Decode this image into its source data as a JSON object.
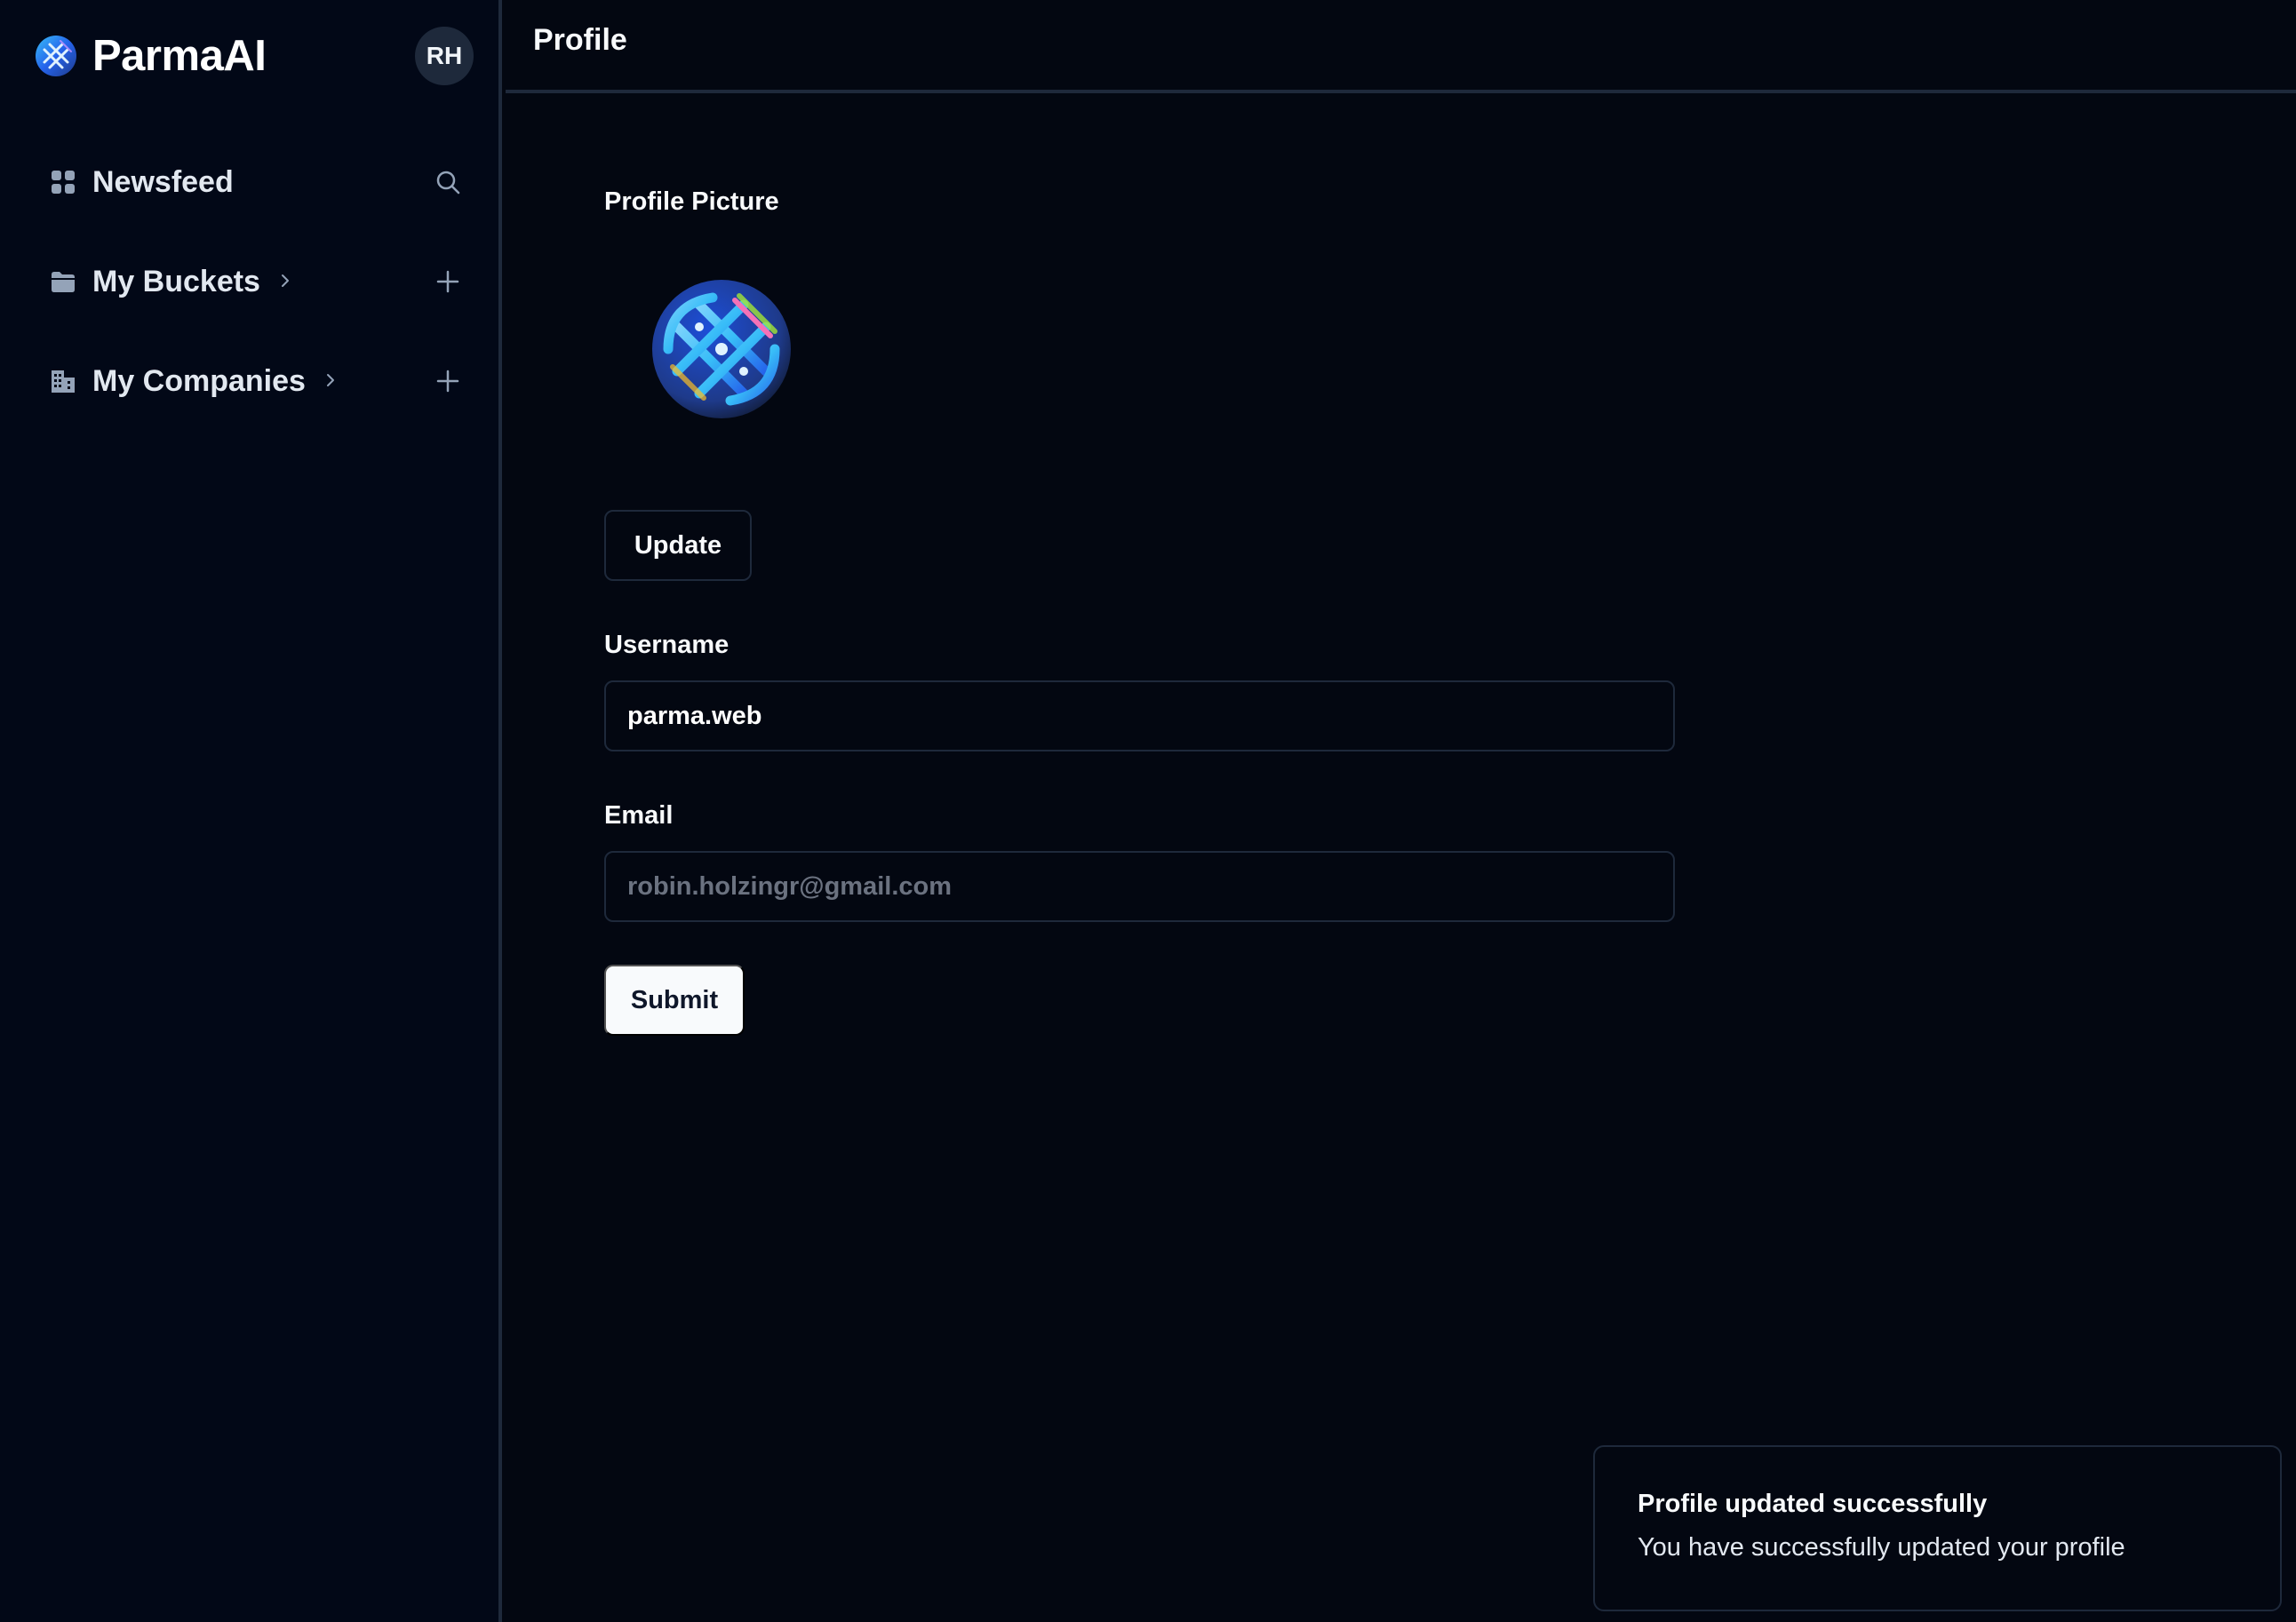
{
  "app": {
    "name": "ParmaAI",
    "user_initials": "RH"
  },
  "sidebar": {
    "items": [
      {
        "label": "Newsfeed",
        "icon": "grid-icon",
        "action_icon": "search-icon"
      },
      {
        "label": "My Buckets",
        "icon": "folder-icon",
        "action_icon": "plus-icon"
      },
      {
        "label": "My Companies",
        "icon": "building-icon",
        "action_icon": "plus-icon"
      }
    ]
  },
  "header": {
    "title": "Profile"
  },
  "form": {
    "profile_picture_label": "Profile Picture",
    "update_button": "Update",
    "username_label": "Username",
    "username_value": "parma.web",
    "email_label": "Email",
    "email_placeholder": "robin.holzingr@gmail.com",
    "submit_button": "Submit"
  },
  "toast": {
    "title": "Profile updated successfully",
    "description": "You have successfully updated your profile"
  },
  "colors": {
    "background": "#030711",
    "sidebar_background": "#020817",
    "border": "#1e293b",
    "primary_button": "#f8fafc"
  }
}
